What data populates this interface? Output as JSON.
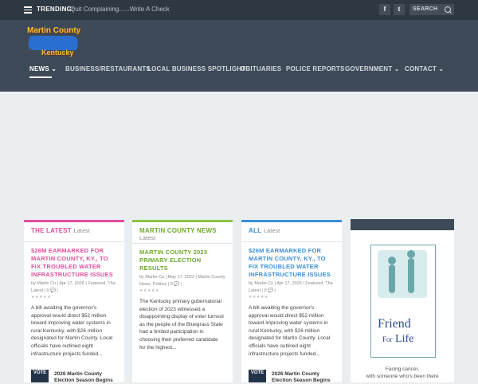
{
  "topbar": {
    "trending_label": "TRENDING:",
    "trending_text": "Quit Complaining......Write A Check",
    "facebook": "f",
    "twitter": "t",
    "search_label": "SEARCH"
  },
  "logo": {
    "line1": "Martin County",
    "line2": "Kentucky"
  },
  "nav": {
    "items": [
      {
        "label": "NEWS"
      },
      {
        "label": "BUSINESS/RESTAURANTS"
      },
      {
        "label": "LOCAL BUSINESS SPOTLIGHT"
      },
      {
        "label": "OBITUARIES"
      },
      {
        "label": "POLICE REPORTS"
      },
      {
        "label": "GOVERNMENT"
      },
      {
        "label": "CONTACT"
      }
    ]
  },
  "columns": [
    {
      "header": "THE LATEST",
      "sub": "Latest",
      "accent": "#e14d9a",
      "title": "$26M EARMARKED FOR MARTIN COUNTY, KY., TO FIX TROUBLED WATER INFRASTRUCTURE ISSUES",
      "meta": "by Martin Co | Apr 17, 2026 | Featured, The Latest | 0 💬 |",
      "excerpt": "A bill awaiting the governor's approval would direct $52 million toward improving water systems in rural Kentucky, with $26 million designated for Martin County. Local officials have outlined eight infrastructure projects funded...",
      "next_thumb": "VOTE",
      "next_title": "2026 Martin County Election Season Begins"
    },
    {
      "header": "MARTIN COUNTY NEWS",
      "sub": "Latest",
      "accent": "#8cc63f",
      "title": "MARTIN COUNTY 2023 PRIMARY ELECTION RESULTS",
      "meta": "by Martin Co | May 17, 2023 | Martin County News, Politics | 0 💬 |",
      "excerpt": "The Kentucky primary gubernatorial election of 2023 witnessed a disappointing display of voter turnout as the people of the Bluegrass State had a limited participation in choosing their preferred candidate for the highest...",
      "next_thumb": "",
      "next_title": ""
    },
    {
      "header": "ALL",
      "sub": "Latest",
      "accent": "#3a8fd6",
      "title": "$26M EARMARKED FOR MARTIN COUNTY, KY., TO FIX TROUBLED WATER INFRASTRUCTURE ISSUES",
      "meta": "by Martin Co | Apr 17, 2026 | Featured, The Latest | 0 💬 |",
      "excerpt": "A bill awaiting the governor's approval would direct $52 million toward improving water systems in rural Kentucky, with $26 million designated for Martin County. Local officials have outlined eight infrastructure projects funded...",
      "next_thumb": "VOTE",
      "next_title": "2026 Martin County Election Season Begins"
    }
  ],
  "sidebar_ad": {
    "word1": "Friend",
    "word2a": "For",
    "word2b": "Life",
    "caption1": "Facing cancer,",
    "caption2": "with someone who's been there"
  }
}
